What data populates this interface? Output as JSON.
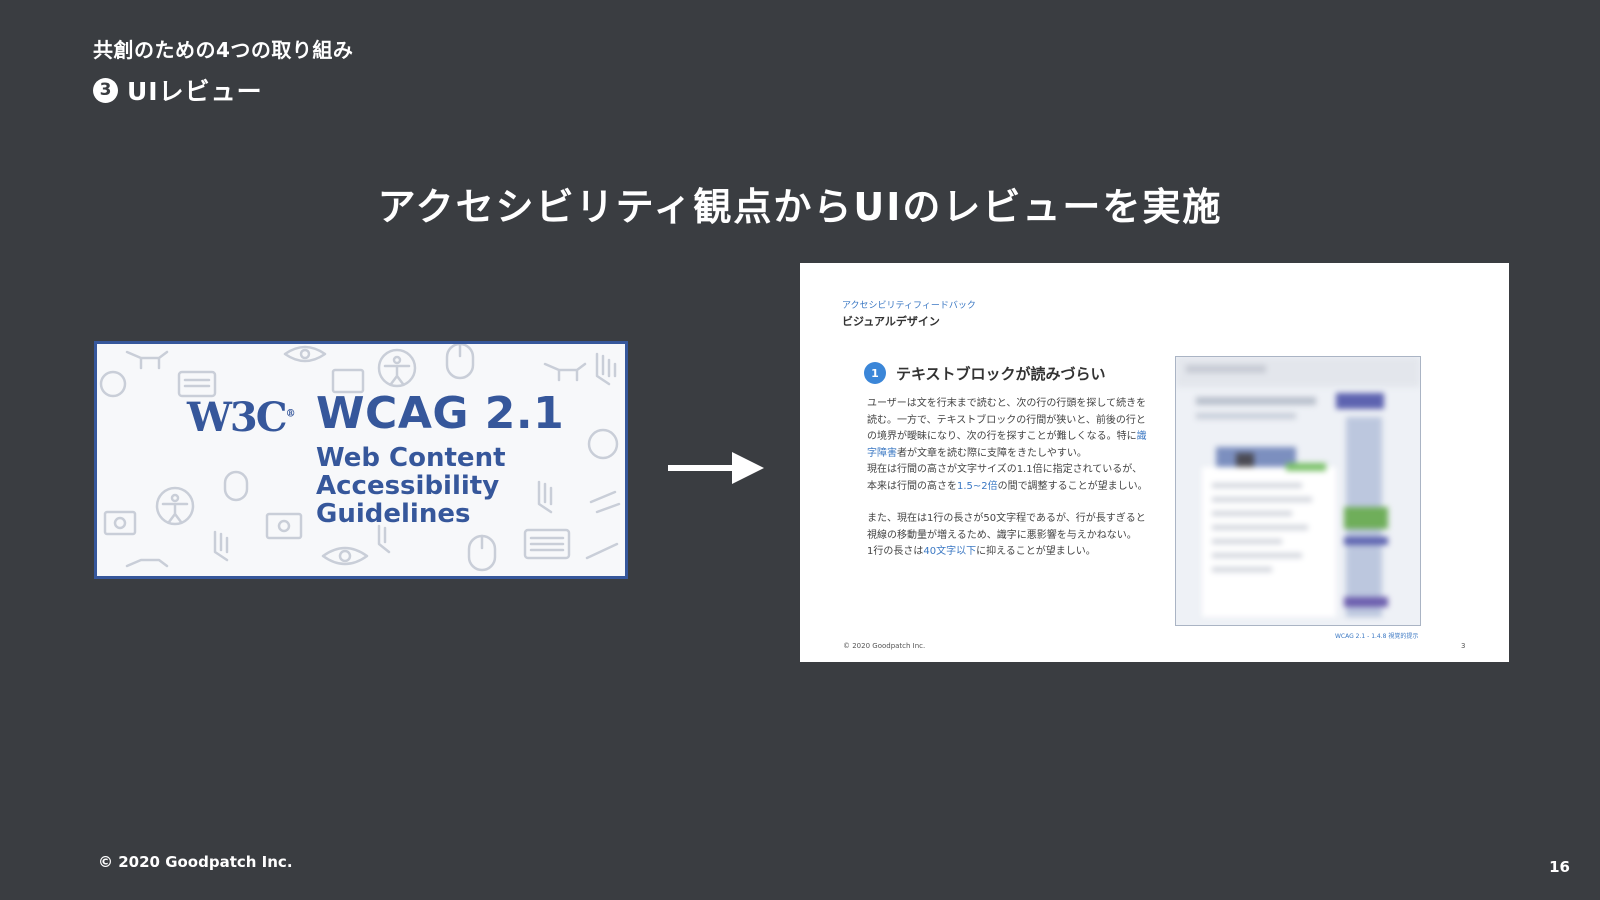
{
  "header": {
    "eyebrow": "共創のための4つの取り組み",
    "section_number": "3",
    "section_title": "UIレビュー"
  },
  "headline": "アクセシビリティ観点からUIのレビューを実施",
  "wcag_banner": {
    "logo": "W3C",
    "logo_mark": "®",
    "version": "WCAG 2.1",
    "name_lines": [
      "Web Content",
      "Accessibility",
      "Guidelines"
    ],
    "brand_color": "#36579b"
  },
  "feedback_slide": {
    "kicker": "アクセシビリティフィードバック",
    "subtitle": "ビジュアルデザイン",
    "item_number": "1",
    "item_title": "テキストブロックが読みづらい",
    "para1": {
      "a": "ユーザーは文を行末まで読むと、次の行の行頭を探して続きを読む。一方で、テキストブロックの行間が狭いと、前後の行との境界が曖昧になり、次の行を探すことが難しくなる。特に",
      "hl": "識字障害",
      "b": "者が文章を読む際に支障をきたしやすい。"
    },
    "para2": {
      "a": "現在は行間の高さが文字サイズの1.1倍に指定されているが、本来は行間の高さを",
      "hl": "1.5~2倍",
      "b": "の間で調整することが望ましい。"
    },
    "para3": "また、現在は1行の長さが50文字程であるが、行が長すぎると視線の移動量が増えるため、識字に悪影響を与えかねない。",
    "para4": {
      "a": "1行の長さは",
      "hl": "40文字以下",
      "b": "に抑えることが望ましい。"
    },
    "reference": "WCAG 2.1 - 1.4.8 視覚的提示",
    "copyright": "© 2020 Goodpatch Inc.",
    "page": "3",
    "accent_color": "#3b78c3"
  },
  "footer": {
    "copyright": "© 2020 Goodpatch Inc.",
    "page_number": "16"
  },
  "colors": {
    "background": "#3a3d41",
    "text": "#ffffff"
  }
}
